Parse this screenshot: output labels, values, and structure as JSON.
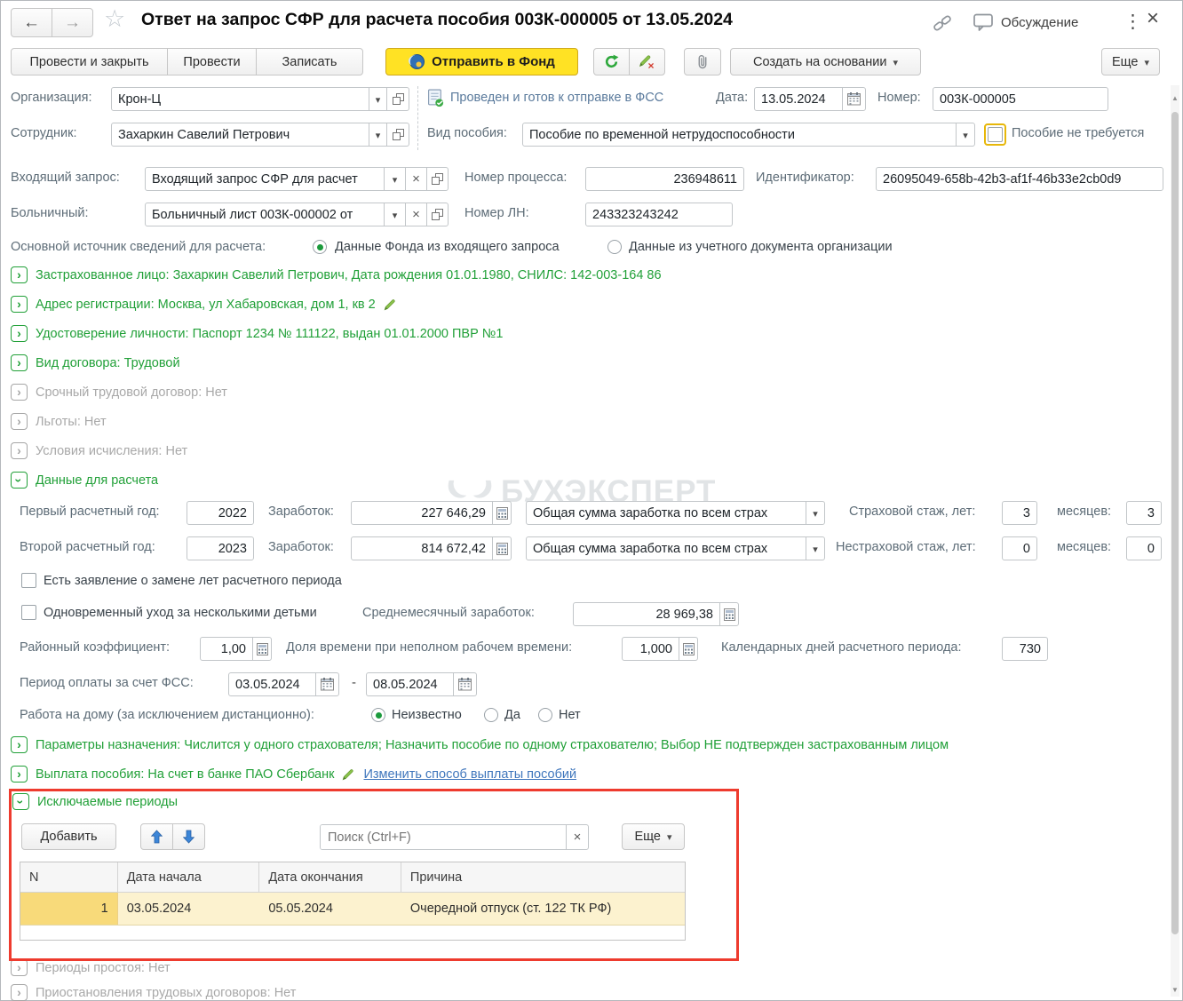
{
  "header": {
    "title": "Ответ на запрос СФР для расчета пособия 003К-000005 от 13.05.2024",
    "discussion": "Обсуждение"
  },
  "toolbar": {
    "post_and_close": "Провести и закрыть",
    "post": "Провести",
    "save": "Записать",
    "send_to_fund": "Отправить в Фонд",
    "create_based_on": "Создать на основании",
    "more": "Еще"
  },
  "form": {
    "organization": {
      "label": "Организация:",
      "value": "Крон-Ц"
    },
    "employee": {
      "label": "Сотрудник:",
      "value": "Захаркин Савелий Петрович"
    },
    "status": "Проведен и готов к отправке в ФСС",
    "date": {
      "label": "Дата:",
      "value": "13.05.2024"
    },
    "number": {
      "label": "Номер:",
      "value": "003К-000005"
    },
    "benefit_type": {
      "label": "Вид пособия:",
      "value": "Пособие по временной нетрудоспособности"
    },
    "benefit_not_required": "Пособие не требуется",
    "incoming_request": {
      "label": "Входящий запрос:",
      "value": "Входящий запрос СФР для расчет"
    },
    "process_number": {
      "label": "Номер процесса:",
      "value": "236948611"
    },
    "identifier": {
      "label": "Идентификатор:",
      "value": "26095049-658b-42b3-af1f-46b33e2cb0d9"
    },
    "sick_leave": {
      "label": "Больничный:",
      "value": "Больничный лист 003К-000002 от"
    },
    "ln_number": {
      "label": "Номер ЛН:",
      "value": "243323243242"
    },
    "source": {
      "label": "Основной источник сведений для расчета:",
      "option_fund": "Данные Фонда из входящего запроса",
      "option_org": "Данные из учетного документа организации"
    }
  },
  "sections": {
    "insured_person": "Застрахованное лицо: Захаркин Савелий Петрович, Дата рождения 01.01.1980, СНИЛС: 142-003-164 86",
    "address": "Адрес регистрации: Москва, ул Хабаровская, дом 1, кв 2",
    "identity": "Удостоверение личности: Паспорт 1234 № 111122, выдан 01.01.2000 ПВР №1",
    "contract_type": "Вид договора: Трудовой",
    "fixed_term": "Срочный трудовой договор: Нет",
    "privileges": "Льготы: Нет",
    "conditions": "Условия исчисления: Нет",
    "calc_data": "Данные для расчета",
    "assignment": "Параметры назначения: Числится у одного страхователя; Назначить пособие по одному страхователю; Выбор НЕ подтвержден застрахованным лицом",
    "payment": "Выплата пособия: На счет в банке ПАО Сбербанк",
    "payment_link": "Изменить способ выплаты пособий",
    "downtime": "Периоды простоя: Нет",
    "suspension": "Приостановления трудовых договоров: Нет"
  },
  "calc": {
    "year1_label": "Первый расчетный год:",
    "year1": "2022",
    "year2_label": "Второй расчетный год:",
    "year2": "2023",
    "earnings_label": "Заработок:",
    "earnings1": "227 646,29",
    "earnings2": "814 672,42",
    "earnings_source": "Общая сумма заработка по всем страх",
    "insured_exp_label": "Страховой стаж, лет:",
    "insured_exp_years": "3",
    "months_label": "месяцев:",
    "insured_exp_months": "3",
    "uninsured_exp_label": "Нестраховой стаж, лет:",
    "uninsured_exp_years": "0",
    "uninsured_exp_months": "0",
    "replace_years": "Есть заявление о замене лет расчетного периода",
    "simultaneous_care": "Одновременный уход за несколькими детьми",
    "avg_monthly_label": "Среднемесячный заработок:",
    "avg_monthly": "28 969,38",
    "district_coef_label": "Районный коэффициент:",
    "district_coef": "1,00",
    "part_time_label": "Доля времени при неполном рабочем времени:",
    "part_time": "1,000",
    "calendar_days_label": "Календарных дней расчетного периода:",
    "calendar_days": "730",
    "fss_period_label": "Период оплаты за счет ФСС:",
    "fss_from": "03.05.2024",
    "fss_to": "08.05.2024",
    "home_work_label": "Работа на дому (за исключением дистанционно):",
    "home_unknown": "Неизвестно",
    "home_yes": "Да",
    "home_no": "Нет"
  },
  "excluded": {
    "title": "Исключаемые периоды",
    "add": "Добавить",
    "search_placeholder": "Поиск (Ctrl+F)",
    "more": "Еще",
    "headers": [
      "N",
      "Дата начала",
      "Дата окончания",
      "Причина"
    ],
    "rows": [
      {
        "n": "1",
        "start": "03.05.2024",
        "end": "05.05.2024",
        "reason": "Очередной отпуск (ст. 122 ТК РФ)"
      }
    ]
  },
  "watermark": "БУХЭКСПЕРТ",
  "colors": {
    "accent_green": "#21a038",
    "highlight_red": "#ee3b2e",
    "send_button_yellow": "#ffe224",
    "row_highlight": "#fcf2cf"
  }
}
